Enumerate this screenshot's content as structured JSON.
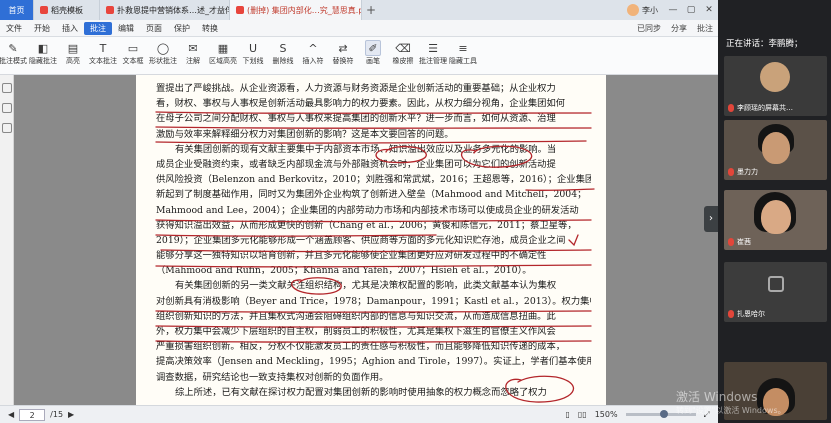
{
  "tabs": {
    "home": "首页",
    "items": [
      {
        "label": "稻壳模板",
        "color": "#e8453c"
      },
      {
        "label": "扑救恩提中营销体系…述_才益伴.pdf",
        "color": "#e8453c"
      },
      {
        "label": "(删掉) 集团内部化…究_慧思真.pdf",
        "color": "#e8453c"
      }
    ],
    "add": "+",
    "user": "李小"
  },
  "menu": {
    "items": [
      "文件",
      "开始",
      "插入",
      "批注",
      "编辑",
      "页面",
      "保护",
      "转换"
    ],
    "active_index": 3,
    "right": [
      "已同步",
      "分享",
      "批注"
    ]
  },
  "toolbar": {
    "tools": [
      {
        "label": "批注模式",
        "icon": "comment-mode-icon",
        "glyph": "✎"
      },
      {
        "label": "隐藏批注",
        "icon": "hide-comment-icon",
        "glyph": "◧"
      },
      {
        "label": "高亮",
        "icon": "highlight-icon",
        "glyph": "▤"
      },
      {
        "label": "文本批注",
        "icon": "text-comment-icon",
        "glyph": "T"
      },
      {
        "label": "文本框",
        "icon": "textbox-icon",
        "glyph": "▭"
      },
      {
        "label": "形状批注",
        "icon": "shape-comment-icon",
        "glyph": "◯"
      },
      {
        "label": "注解",
        "icon": "note-icon",
        "glyph": "✉"
      },
      {
        "label": "区域高亮",
        "icon": "area-highlight-icon",
        "glyph": "▦"
      },
      {
        "label": "下划线",
        "icon": "underline-icon",
        "glyph": "U"
      },
      {
        "label": "删除线",
        "icon": "strikethrough-icon",
        "glyph": "S"
      },
      {
        "label": "插入符",
        "icon": "caret-icon",
        "glyph": "^"
      },
      {
        "label": "替换符",
        "icon": "replace-icon",
        "glyph": "⇄"
      },
      {
        "label": "画笔",
        "icon": "pen-icon",
        "glyph": "✐"
      },
      {
        "label": "橡皮擦",
        "icon": "eraser-icon",
        "glyph": "⌫"
      },
      {
        "label": "批注管理",
        "icon": "comment-manager-icon",
        "glyph": "☰"
      },
      {
        "label": "隐藏工具",
        "icon": "hide-tools-icon",
        "glyph": "≡"
      }
    ],
    "active_index": 12
  },
  "page_text": [
    {
      "indent": false,
      "text": "置提出了严峻挑战。从企业资源看，人力资源与财务资源是企业创新活动的重要基础；从企业权力"
    },
    {
      "indent": false,
      "text": "看，财权、事权与人事权是创新活动最具影响力的权力要素。因此，从权力细分视角，企业集团如何"
    },
    {
      "indent": false,
      "text": "在母子公司之间分配财权、事权与人事权来提高集团的创新水平？进一步而言，如何从资源、治理"
    },
    {
      "indent": false,
      "text": "激励与效率来解释细分权力对集团创新的影响？这是本文要回答的问题。"
    },
    {
      "indent": true,
      "text": "有关集团创新的现有文献主要集中于内部资本市场、知识溢出效应以及业务多元化的影响。当"
    },
    {
      "indent": false,
      "text": "成员企业受融资约束，或者缺乏内部现金流与外部融资机会时，企业集团可以为它们的创新活动提"
    },
    {
      "indent": false,
      "text": "供风险投资（Belenzon and Berkovitz，2010；刘胜强和常武斌，2016；王超恩等，2016）；企业集团对创"
    },
    {
      "indent": false,
      "text": "新起到了制度基础作用，同时又为集团外企业构筑了创新进入壁垒（Mahmood and Mitchell，2004；"
    },
    {
      "indent": false,
      "text": "Mahmood and Lee，2004）；企业集团的内部劳动力市场和内部技术市场可以使成员企业的研发活动"
    },
    {
      "indent": false,
      "text": "获得知识溢出效益，从而形成更快的创新（Chang et al.，2006；黄俊和陈信元，2011；蔡卫星等，"
    },
    {
      "indent": false,
      "text": "2019）；企业集团多元化能够形成一个涵盖顾客、供应商等方面的多元化知识贮存池，成员企业之间"
    },
    {
      "indent": false,
      "text": "能够分享这一独特知识以培育创新，并且多元化能够使企业集团更好应对研发过程中的不确定性"
    },
    {
      "indent": false,
      "text": "（Mahmood and Rufin，2005；Khanna and Yafeh，2007；Hsieh et al.，2010）。"
    },
    {
      "indent": true,
      "text": "有关集团创新的另一类文献关注组织结构，尤其是决策权配置的影响，此类文献基本认为集权"
    },
    {
      "indent": false,
      "text": "对创新具有消极影响（Beyer and Trice，1978；Damanpour，1991；Kastl et al.，2013）。权力集中会减少"
    },
    {
      "indent": false,
      "text": "组织创新知识的方法，并且集权式沟通会阻碍组织内部的信息与知识交流，从而造成信息扭曲。此"
    },
    {
      "indent": false,
      "text": "外，权力集中会减少下层组织的自主权，削弱员工的积极性，尤其是集权下滋生的官僚主义作风会"
    },
    {
      "indent": false,
      "text": "严重损害组织创新。相反，分权不仅能激发员工的责任感与积极性，而且能够降低知识传递的成本，"
    },
    {
      "indent": false,
      "text": "提高决策效率（Jensen and Meckling，1995；Aghion and Tirole，1997）。实证上，学者们基本使用问卷"
    },
    {
      "indent": false,
      "text": "调查数据，研究结论也一致支持集权对创新的负面作用。"
    },
    {
      "indent": true,
      "text": "综上所述，已有文献在探讨权力配置对集团创新的影响时使用抽象的权力概念而忽略了权力"
    }
  ],
  "statusbar": {
    "current_page": "2",
    "total_pages": "/15",
    "zoom": "150%",
    "zoom_fraction": 0.55
  },
  "meeting": {
    "speaking": "正在讲话：李鹏腾；",
    "participants": [
      {
        "name": "李顾瑶的屏幕共…",
        "skin": "#d4a87e"
      },
      {
        "name": "墨力力",
        "skin": "#c99a74"
      },
      {
        "name": "崔茜",
        "skin": "#d9a985"
      },
      {
        "name": "扎恩哈尔",
        "skin": "#ccc"
      },
      {
        "name": "",
        "skin": "#c48d63"
      }
    ],
    "arrow": "›"
  },
  "watermark": {
    "line1": "激活 Windows",
    "line2": "转到\"设置\"以激活 Windows。"
  },
  "colors": {
    "ink": "#b3262b",
    "tab_active": "#2f6fd6",
    "meeting_bg": "#202124"
  }
}
